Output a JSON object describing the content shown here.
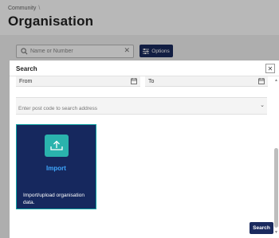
{
  "breadcrumb": {
    "item": "Community",
    "separator": "\\"
  },
  "page": {
    "title": "Organisation"
  },
  "toolbar": {
    "search_placeholder": "Name or Number",
    "clear_symbol": "✕",
    "options_label": "Options"
  },
  "modal": {
    "title": "Search",
    "close_symbol": "✕",
    "from_label": "From",
    "to_label": "To",
    "address_placeholder": "Enter post code to search address",
    "search_button_label": "Search"
  },
  "import_card": {
    "title": "Import",
    "description": "Import/upload organisation data.",
    "icon": "upload-icon"
  },
  "colors": {
    "brand_navy": "#1a2a5e",
    "card_bg": "#16285e",
    "teal": "#2ab3ad",
    "link_blue": "#3fa8ff"
  }
}
